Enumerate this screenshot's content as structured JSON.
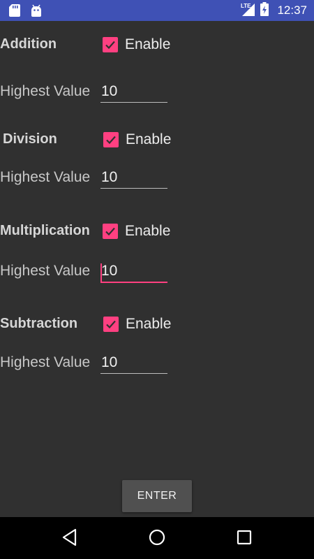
{
  "status_bar": {
    "time": "12:37",
    "network": "LTE",
    "icons": [
      "sd-card-icon",
      "android-icon",
      "lte-signal-icon",
      "battery-icon"
    ]
  },
  "operations": [
    {
      "title": "Addition",
      "enable_label": "Enable",
      "enabled": true,
      "highest_value_label": "Highest Value",
      "highest_value": "10"
    },
    {
      "title": "Division",
      "enable_label": "Enable",
      "enabled": true,
      "highest_value_label": "Highest Value",
      "highest_value": "10"
    },
    {
      "title": "Multiplication",
      "enable_label": "Enable",
      "enabled": true,
      "highest_value_label": "Highest Value",
      "highest_value": "10",
      "focused": true
    },
    {
      "title": "Subtraction",
      "enable_label": "Enable",
      "enabled": true,
      "highest_value_label": "Highest Value",
      "highest_value": "10"
    }
  ],
  "enter_button": {
    "label": "ENTER"
  },
  "nav_bar": {
    "icons": [
      "back-icon",
      "home-icon",
      "recents-icon"
    ]
  },
  "colors": {
    "accent": "#ff4081",
    "status_bar": "#3f51b5",
    "background": "#303030",
    "button": "#505050"
  }
}
